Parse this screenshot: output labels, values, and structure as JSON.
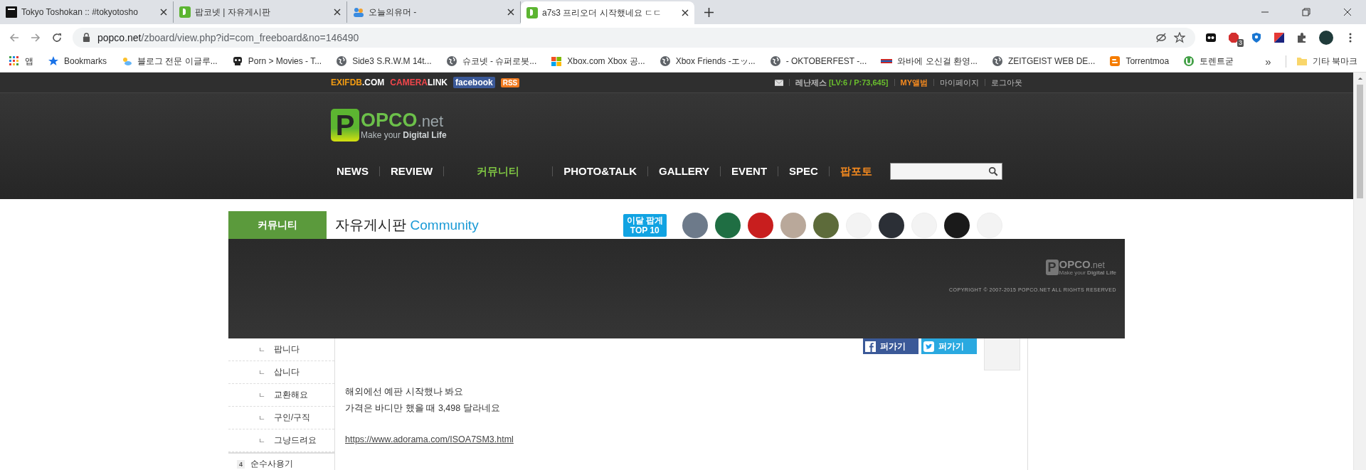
{
  "browser": {
    "tabs": [
      {
        "title": "Tokyo Toshokan :: #tokyotosho",
        "kind": "tt",
        "selected": false
      },
      {
        "title": "팝코넷 | 자유게시판",
        "kind": "popco",
        "selected": false
      },
      {
        "title": "오늘의유머 -",
        "kind": "ou",
        "selected": false
      },
      {
        "title": "a7s3 프리오더 시작했네요 ㄷㄷ",
        "kind": "popco",
        "selected": true
      }
    ],
    "url_host": "popco.net",
    "url_path": "/zboard/view.php?id=com_freeboard&no=146490",
    "extension_badge": "3",
    "bookmarks": [
      {
        "label": "앱",
        "kind": "apps"
      },
      {
        "label": "Bookmarks",
        "kind": "star"
      },
      {
        "label": "블로그 전문 이글루...",
        "kind": "weather"
      },
      {
        "label": "Porn > Movies - T...",
        "kind": "skull"
      },
      {
        "label": "Side3 S.R.W.M 14t...",
        "kind": "globe"
      },
      {
        "label": "슈코넷 - 슈퍼로봇...",
        "kind": "globe"
      },
      {
        "label": "Xbox.com  Xbox 공...",
        "kind": "windows"
      },
      {
        "label": "Xbox Friends -エッ...",
        "kind": "globe"
      },
      {
        "label": "- OKTOBERFEST -...",
        "kind": "globe"
      },
      {
        "label": "와바에 오신걸 환영...",
        "kind": "flag"
      },
      {
        "label": "ZEITGEIST WEB DE...",
        "kind": "globe"
      },
      {
        "label": "Torrentmoa",
        "kind": "blogger"
      },
      {
        "label": "토렌트굳",
        "kind": "utorrent"
      }
    ],
    "overflow": "»",
    "other_bookmarks": "기타 북마크"
  },
  "site": {
    "top_links": [
      {
        "accent": "EXIFDB",
        "rest": ".COM",
        "kind": "exif"
      },
      {
        "accent": "CAMERA",
        "rest": "LINK",
        "kind": "camera"
      },
      {
        "accent": "facebook",
        "kind": "facebook"
      },
      {
        "accent": "RSS",
        "kind": "rss"
      }
    ],
    "user": {
      "name": "레난제스",
      "level": "[LV:6 / P:73,645]"
    },
    "user_links": [
      {
        "label": "MY앨범",
        "kind": "highlight"
      },
      {
        "label": "마이페이지",
        "kind": "normal"
      },
      {
        "label": "로그아웃",
        "kind": "normal"
      }
    ],
    "logo": {
      "letter": "P",
      "name": "OPCO",
      "suffix": ".net",
      "tagline": "Make your",
      "tagline_bold": "Digital Life"
    },
    "nav": [
      {
        "label": "NEWS",
        "kind": "normal",
        "selected": false
      },
      {
        "label": "REVIEW",
        "kind": "normal",
        "selected": false
      },
      {
        "label": "커뮤니티",
        "kind": "normal",
        "selected": true
      },
      {
        "label": "PHOTO&TALK",
        "kind": "normal",
        "selected": false
      },
      {
        "label": "GALLERY",
        "kind": "normal",
        "selected": false
      },
      {
        "label": "EVENT",
        "kind": "normal",
        "selected": false
      },
      {
        "label": "SPEC",
        "kind": "normal",
        "selected": false
      },
      {
        "label": "팝포토",
        "kind": "highlight",
        "selected": false
      }
    ],
    "section": "커뮤니티",
    "board_title": "자유게시판",
    "board_subtitle": "Community",
    "top10_badge": [
      "이달 팝게",
      "TOP 10"
    ],
    "avatars": [
      {
        "kind": "photo"
      },
      {
        "kind": "photo"
      },
      {
        "kind": "photo"
      },
      {
        "kind": "photo"
      },
      {
        "kind": "photo"
      },
      {
        "kind": "placeholder"
      },
      {
        "kind": "photo"
      },
      {
        "kind": "placeholder"
      },
      {
        "kind": "photo"
      },
      {
        "kind": "placeholder"
      }
    ],
    "overlay": {
      "logo_letter": "P",
      "logo_name": "OPCO",
      "logo_suffix": ".net",
      "tagline": "Make your",
      "tagline_bold": "Digital Life",
      "copyright": "COPYRIGHT © 2007-2015 POPCO.NET ALL RIGHTS RESERVED"
    },
    "sidebar": [
      {
        "label": "팝니다",
        "marker": "ㄴ",
        "kind": "sub"
      },
      {
        "label": "삽니다",
        "marker": "ㄴ",
        "kind": "sub"
      },
      {
        "label": "교환해요",
        "marker": "ㄴ",
        "kind": "sub"
      },
      {
        "label": "구인/구직",
        "marker": "ㄴ",
        "kind": "sub"
      },
      {
        "label": "그냥드려요",
        "marker": "ㄴ",
        "kind": "sub"
      },
      {
        "label": "순수사용기",
        "marker": "4",
        "kind": "numbered"
      }
    ],
    "share_buttons": [
      {
        "label": "퍼가기",
        "kind": "facebook"
      },
      {
        "label": "퍼가기",
        "kind": "twitter"
      }
    ],
    "body_lines": [
      "해외에선 예판 시작했나 봐요",
      "가격은 바디만 했을 때 3,498 달라네요"
    ],
    "link": "https://www.adorama.com/ISOA7SM3.html"
  }
}
